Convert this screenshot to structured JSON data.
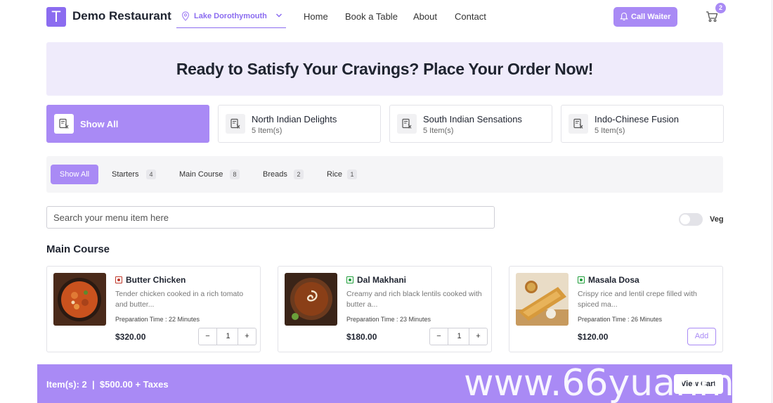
{
  "header": {
    "logo_letter": "T",
    "brand": "Demo Restaurant",
    "location": "Lake Dorothymouth",
    "nav": [
      "Home",
      "Book a Table",
      "About",
      "Contact"
    ],
    "call_waiter": "Call Waiter",
    "cart_count": "2"
  },
  "hero": {
    "headline": "Ready to Satisfy Your Cravings? Place Your Order Now!"
  },
  "categories": [
    {
      "title": "Show All",
      "subtitle": ""
    },
    {
      "title": "North Indian Delights",
      "subtitle": "5 Item(s)"
    },
    {
      "title": "South Indian Sensations",
      "subtitle": "5 Item(s)"
    },
    {
      "title": "Indo-Chinese Fusion",
      "subtitle": "5 Item(s)"
    }
  ],
  "subtabs": [
    {
      "label": "Show All",
      "count": ""
    },
    {
      "label": "Starters",
      "count": "4"
    },
    {
      "label": "Main Course",
      "count": "8"
    },
    {
      "label": "Breads",
      "count": "2"
    },
    {
      "label": "Rice",
      "count": "1"
    }
  ],
  "search": {
    "placeholder": "Search your menu item here"
  },
  "veg_toggle": {
    "label": "Veg",
    "on": false
  },
  "section_title": "Main Course",
  "dishes": [
    {
      "name": "Butter Chicken",
      "desc": "Tender chicken cooked in a rich tomato and butter...",
      "prep": "Preparation Time : 22 Minutes",
      "price": "$320.00",
      "qty": "1",
      "type": "non-veg"
    },
    {
      "name": "Dal Makhani",
      "desc": "Creamy and rich black lentils cooked with butter a...",
      "prep": "Preparation Time : 23 Minutes",
      "price": "$180.00",
      "qty": "1",
      "type": "veg"
    },
    {
      "name": "Masala Dosa",
      "desc": "Crispy rice and lentil crepe filled with spiced ma...",
      "prep": "Preparation Time : 26 Minutes",
      "price": "$120.00",
      "add_label": "Add",
      "type": "veg"
    }
  ],
  "stepper": {
    "minus": "−",
    "plus": "+"
  },
  "bottom_bar": {
    "summary": "Item(s): 2  |  $500.00 + Taxes",
    "view_cart": "View Cart"
  },
  "watermark": "www.66yuanma.cn",
  "colors": {
    "accent": "#a98af5",
    "logo": "#8b6cf0",
    "hero_bg": "#efebfb",
    "veg": "#1f9d3a",
    "non_veg": "#c0392b"
  }
}
